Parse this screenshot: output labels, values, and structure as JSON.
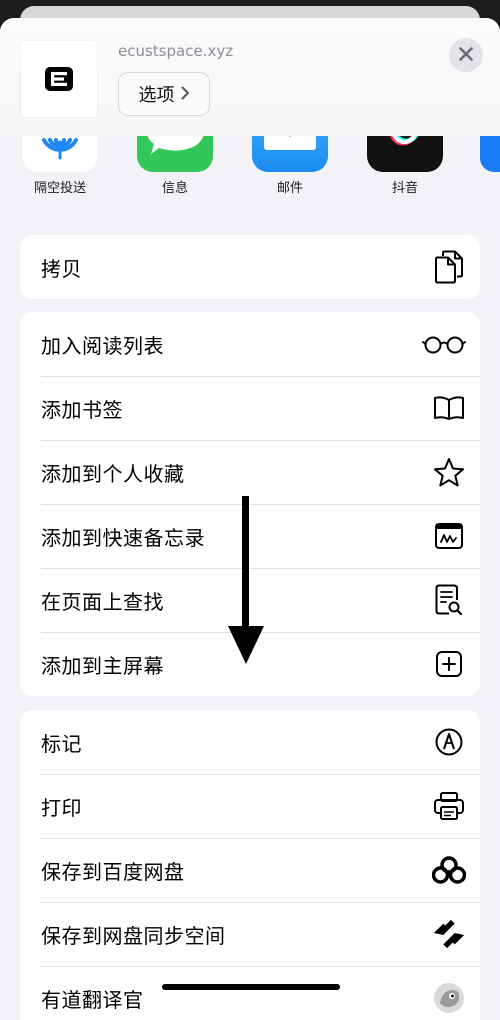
{
  "header": {
    "site_url": "ecustspace.xyz",
    "options_label": "选项",
    "site_icon_name": "site-logo-icon",
    "close_icon_name": "close-icon"
  },
  "apps": [
    {
      "label": "隔空投送",
      "icon": "airdrop-icon",
      "color": "#ffffff"
    },
    {
      "label": "信息",
      "icon": "messages-icon",
      "color": "#34c759"
    },
    {
      "label": "邮件",
      "icon": "mail-icon",
      "color": "#1e9bf7"
    },
    {
      "label": "抖音",
      "icon": "douyin-icon",
      "color": "#111111"
    }
  ],
  "actions": {
    "group1": [
      {
        "label": "拷贝",
        "icon": "copy-icon"
      }
    ],
    "group2": [
      {
        "label": "加入阅读列表",
        "icon": "glasses-icon"
      },
      {
        "label": "添加书签",
        "icon": "book-icon"
      },
      {
        "label": "添加到个人收藏",
        "icon": "star-icon"
      },
      {
        "label": "添加到快速备忘录",
        "icon": "quick-note-icon"
      },
      {
        "label": "在页面上查找",
        "icon": "find-on-page-icon"
      },
      {
        "label": "添加到主屏幕",
        "icon": "add-square-icon"
      }
    ],
    "group3": [
      {
        "label": "标记",
        "icon": "markup-icon"
      },
      {
        "label": "打印",
        "icon": "printer-icon"
      },
      {
        "label": "保存到百度网盘",
        "icon": "baidu-netdisk-icon"
      },
      {
        "label": "保存到网盘同步空间",
        "icon": "netdisk-sync-icon"
      },
      {
        "label": "有道翻译官",
        "icon": "youdao-translate-icon"
      }
    ]
  }
}
